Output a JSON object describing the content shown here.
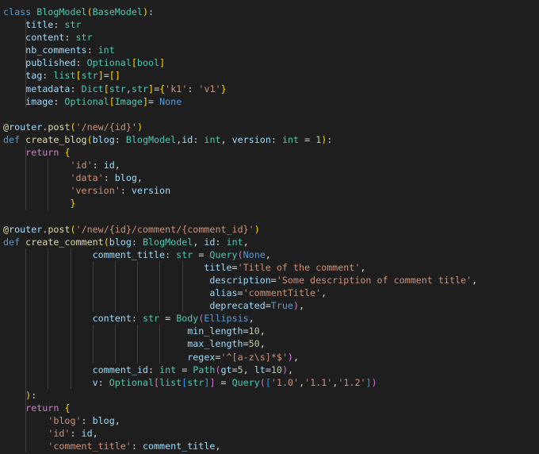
{
  "colors": {
    "background": "#1e1e1e",
    "default": "#d4d4d4",
    "keyword": "#569cd6",
    "control": "#c586c0",
    "function": "#dcdcaa",
    "class": "#4ec9b0",
    "variable": "#9cdcfe",
    "string": "#ce9178",
    "number": "#b5cea8",
    "bracket1": "#ffd700",
    "bracket2": "#da70d6",
    "bracket3": "#179fff",
    "indent_guide": "#404040"
  },
  "lines": [
    {
      "g": [],
      "t": [
        [
          "class",
          "kw"
        ],
        [
          " ",
          ""
        ],
        [
          "BlogModel",
          "cls"
        ],
        [
          "(",
          "br1"
        ],
        [
          "BaseModel",
          "cls"
        ],
        [
          ")",
          "br1"
        ],
        [
          ":",
          "pn"
        ]
      ]
    },
    {
      "g": [
        4
      ],
      "t": [
        [
          "    ",
          ""
        ],
        [
          "title",
          "var"
        ],
        [
          ": ",
          "pn"
        ],
        [
          "str",
          "cls"
        ]
      ]
    },
    {
      "g": [
        4
      ],
      "t": [
        [
          "    ",
          ""
        ],
        [
          "content",
          "var"
        ],
        [
          ": ",
          "pn"
        ],
        [
          "str",
          "cls"
        ]
      ]
    },
    {
      "g": [
        4
      ],
      "t": [
        [
          "    ",
          ""
        ],
        [
          "nb_comments",
          "var"
        ],
        [
          ": ",
          "pn"
        ],
        [
          "int",
          "cls"
        ]
      ]
    },
    {
      "g": [
        4
      ],
      "t": [
        [
          "    ",
          ""
        ],
        [
          "published",
          "var"
        ],
        [
          ": ",
          "pn"
        ],
        [
          "Optional",
          "cls"
        ],
        [
          "[",
          "br1"
        ],
        [
          "bool",
          "cls"
        ],
        [
          "]",
          "br1"
        ]
      ]
    },
    {
      "g": [
        4
      ],
      "t": [
        [
          "    ",
          ""
        ],
        [
          "tag",
          "var"
        ],
        [
          ": ",
          "pn"
        ],
        [
          "list",
          "cls"
        ],
        [
          "[",
          "br1"
        ],
        [
          "str",
          "cls"
        ],
        [
          "]",
          "br1"
        ],
        [
          "=",
          "pn"
        ],
        [
          "[",
          "br1"
        ],
        [
          "]",
          "br1"
        ]
      ]
    },
    {
      "g": [
        4
      ],
      "t": [
        [
          "    ",
          ""
        ],
        [
          "metadata",
          "var"
        ],
        [
          ": ",
          "pn"
        ],
        [
          "Dict",
          "cls"
        ],
        [
          "[",
          "br1"
        ],
        [
          "str",
          "cls"
        ],
        [
          ",",
          "pn"
        ],
        [
          "str",
          "cls"
        ],
        [
          "]",
          "br1"
        ],
        [
          "=",
          "pn"
        ],
        [
          "{",
          "br1"
        ],
        [
          "'k1'",
          "str"
        ],
        [
          ": ",
          "pn"
        ],
        [
          "'v1'",
          "str"
        ],
        [
          "}",
          "br1"
        ]
      ]
    },
    {
      "g": [
        4
      ],
      "t": [
        [
          "    ",
          ""
        ],
        [
          "image",
          "var"
        ],
        [
          ": ",
          "pn"
        ],
        [
          "Optional",
          "cls"
        ],
        [
          "[",
          "br1"
        ],
        [
          "Image",
          "cls"
        ],
        [
          "]",
          "br1"
        ],
        [
          "= ",
          "pn"
        ],
        [
          "None",
          "const"
        ]
      ]
    },
    {
      "g": [],
      "t": []
    },
    {
      "g": [],
      "t": [
        [
          "@",
          "fn"
        ],
        [
          "router",
          "var"
        ],
        [
          ".",
          "pn"
        ],
        [
          "post",
          "fn"
        ],
        [
          "(",
          "br1"
        ],
        [
          "'/new/{id}'",
          "str"
        ],
        [
          ")",
          "br1"
        ]
      ]
    },
    {
      "g": [],
      "t": [
        [
          "def",
          "kw"
        ],
        [
          " ",
          ""
        ],
        [
          "create_blog",
          "fn"
        ],
        [
          "(",
          "br1"
        ],
        [
          "blog",
          "var"
        ],
        [
          ": ",
          "pn"
        ],
        [
          "BlogModel",
          "cls"
        ],
        [
          ",",
          "pn"
        ],
        [
          "id",
          "var"
        ],
        [
          ": ",
          "pn"
        ],
        [
          "int",
          "cls"
        ],
        [
          ", ",
          "pn"
        ],
        [
          "version",
          "var"
        ],
        [
          ": ",
          "pn"
        ],
        [
          "int",
          "cls"
        ],
        [
          " = ",
          "pn"
        ],
        [
          "1",
          "num"
        ],
        [
          ")",
          "br1"
        ],
        [
          ":",
          "pn"
        ]
      ]
    },
    {
      "g": [
        4
      ],
      "t": [
        [
          "    ",
          ""
        ],
        [
          "return",
          "kw2"
        ],
        [
          " ",
          ""
        ],
        [
          "{",
          "br1"
        ]
      ]
    },
    {
      "g": [
        4,
        8
      ],
      "t": [
        [
          "            ",
          ""
        ],
        [
          "'id'",
          "str"
        ],
        [
          ": ",
          "pn"
        ],
        [
          "id",
          "var"
        ],
        [
          ",",
          "pn"
        ]
      ]
    },
    {
      "g": [
        4,
        8
      ],
      "t": [
        [
          "            ",
          ""
        ],
        [
          "'data'",
          "str"
        ],
        [
          ": ",
          "pn"
        ],
        [
          "blog",
          "var"
        ],
        [
          ",",
          "pn"
        ]
      ]
    },
    {
      "g": [
        4,
        8
      ],
      "t": [
        [
          "            ",
          ""
        ],
        [
          "'version'",
          "str"
        ],
        [
          ": ",
          "pn"
        ],
        [
          "version",
          "var"
        ]
      ]
    },
    {
      "g": [
        4,
        8
      ],
      "t": [
        [
          "            ",
          ""
        ],
        [
          "}",
          "br1"
        ]
      ]
    },
    {
      "g": [],
      "t": []
    },
    {
      "g": [],
      "t": [
        [
          "@",
          "fn"
        ],
        [
          "router",
          "var"
        ],
        [
          ".",
          "pn"
        ],
        [
          "post",
          "fn"
        ],
        [
          "(",
          "br1"
        ],
        [
          "'/new/{id}/comment/{comment_id}'",
          "str"
        ],
        [
          ")",
          "br1"
        ]
      ]
    },
    {
      "g": [],
      "t": [
        [
          "def",
          "kw"
        ],
        [
          " ",
          ""
        ],
        [
          "create_comment",
          "fn"
        ],
        [
          "(",
          "br1"
        ],
        [
          "blog",
          "var"
        ],
        [
          ": ",
          "pn"
        ],
        [
          "BlogModel",
          "cls"
        ],
        [
          ", ",
          "pn"
        ],
        [
          "id",
          "var"
        ],
        [
          ": ",
          "pn"
        ],
        [
          "int",
          "cls"
        ],
        [
          ",",
          "pn"
        ]
      ]
    },
    {
      "g": [
        4,
        8,
        12
      ],
      "t": [
        [
          "                ",
          ""
        ],
        [
          "comment_title",
          "var"
        ],
        [
          ": ",
          "pn"
        ],
        [
          "str",
          "cls"
        ],
        [
          " = ",
          "pn"
        ],
        [
          "Query",
          "cls"
        ],
        [
          "(",
          "br2"
        ],
        [
          "None",
          "const"
        ],
        [
          ",",
          "pn"
        ]
      ]
    },
    {
      "g": [
        4,
        8,
        12,
        16,
        20,
        24,
        28,
        32
      ],
      "t": [
        [
          "                                    ",
          ""
        ],
        [
          "title",
          "var"
        ],
        [
          "=",
          "pn"
        ],
        [
          "'Title of the comment'",
          "str"
        ],
        [
          ",",
          "pn"
        ]
      ]
    },
    {
      "g": [
        4,
        8,
        12,
        16,
        20,
        24,
        28,
        32
      ],
      "t": [
        [
          "                                     ",
          ""
        ],
        [
          "description",
          "var"
        ],
        [
          "=",
          "pn"
        ],
        [
          "'Some description of comment title'",
          "str"
        ],
        [
          ",",
          "pn"
        ]
      ]
    },
    {
      "g": [
        4,
        8,
        12,
        16,
        20,
        24,
        28,
        32
      ],
      "t": [
        [
          "                                     ",
          ""
        ],
        [
          "alias",
          "var"
        ],
        [
          "=",
          "pn"
        ],
        [
          "'commentTitle'",
          "str"
        ],
        [
          ",",
          "pn"
        ]
      ]
    },
    {
      "g": [
        4,
        8,
        12,
        16,
        20,
        24,
        28,
        32
      ],
      "t": [
        [
          "                                     ",
          ""
        ],
        [
          "deprecated",
          "var"
        ],
        [
          "=",
          "pn"
        ],
        [
          "True",
          "const"
        ],
        [
          ")",
          "br2"
        ],
        [
          ",",
          "pn"
        ]
      ]
    },
    {
      "g": [
        4,
        8,
        12
      ],
      "t": [
        [
          "                ",
          ""
        ],
        [
          "content",
          "var"
        ],
        [
          ": ",
          "pn"
        ],
        [
          "str",
          "cls"
        ],
        [
          " = ",
          "pn"
        ],
        [
          "Body",
          "cls"
        ],
        [
          "(",
          "br2"
        ],
        [
          "Ellipsis",
          "const"
        ],
        [
          ",",
          "pn"
        ]
      ]
    },
    {
      "g": [
        4,
        8,
        12,
        16,
        20,
        24,
        28
      ],
      "t": [
        [
          "                                 ",
          ""
        ],
        [
          "min_length",
          "var"
        ],
        [
          "=",
          "pn"
        ],
        [
          "10",
          "num"
        ],
        [
          ",",
          "pn"
        ]
      ]
    },
    {
      "g": [
        4,
        8,
        12,
        16,
        20,
        24,
        28
      ],
      "t": [
        [
          "                                 ",
          ""
        ],
        [
          "max_length",
          "var"
        ],
        [
          "=",
          "pn"
        ],
        [
          "50",
          "num"
        ],
        [
          ",",
          "pn"
        ]
      ]
    },
    {
      "g": [
        4,
        8,
        12,
        16,
        20,
        24,
        28
      ],
      "t": [
        [
          "                                 ",
          ""
        ],
        [
          "regex",
          "var"
        ],
        [
          "=",
          "pn"
        ],
        [
          "'^[a-z\\s]*$'",
          "str"
        ],
        [
          ")",
          "br2"
        ],
        [
          ",",
          "pn"
        ]
      ]
    },
    {
      "g": [
        4,
        8,
        12
      ],
      "t": [
        [
          "                ",
          ""
        ],
        [
          "comment_id",
          "var"
        ],
        [
          ": ",
          "pn"
        ],
        [
          "int",
          "cls"
        ],
        [
          " = ",
          "pn"
        ],
        [
          "Path",
          "cls"
        ],
        [
          "(",
          "br2"
        ],
        [
          "gt",
          "var"
        ],
        [
          "=",
          "pn"
        ],
        [
          "5",
          "num"
        ],
        [
          ", ",
          "pn"
        ],
        [
          "lt",
          "var"
        ],
        [
          "=",
          "pn"
        ],
        [
          "10",
          "num"
        ],
        [
          ")",
          "br2"
        ],
        [
          ",",
          "pn"
        ]
      ]
    },
    {
      "g": [
        4,
        8,
        12
      ],
      "t": [
        [
          "                ",
          ""
        ],
        [
          "v",
          "var"
        ],
        [
          ": ",
          "pn"
        ],
        [
          "Optional",
          "cls"
        ],
        [
          "[",
          "br2"
        ],
        [
          "list",
          "cls"
        ],
        [
          "[",
          "br3"
        ],
        [
          "str",
          "cls"
        ],
        [
          "]",
          "br3"
        ],
        [
          "]",
          "br2"
        ],
        [
          " = ",
          "pn"
        ],
        [
          "Query",
          "cls"
        ],
        [
          "(",
          "br2"
        ],
        [
          "[",
          "br3"
        ],
        [
          "'1.0'",
          "str"
        ],
        [
          ",",
          "pn"
        ],
        [
          "'1.1'",
          "str"
        ],
        [
          ",",
          "pn"
        ],
        [
          "'1.2'",
          "str"
        ],
        [
          "]",
          "br3"
        ],
        [
          ")",
          "br2"
        ]
      ]
    },
    {
      "g": [
        4
      ],
      "t": [
        [
          "    ",
          ""
        ],
        [
          ")",
          "br1"
        ],
        [
          ":",
          "pn"
        ]
      ]
    },
    {
      "g": [
        4
      ],
      "t": [
        [
          "    ",
          ""
        ],
        [
          "return",
          "kw2"
        ],
        [
          " ",
          ""
        ],
        [
          "{",
          "br1"
        ]
      ]
    },
    {
      "g": [
        4
      ],
      "t": [
        [
          "        ",
          ""
        ],
        [
          "'blog'",
          "str"
        ],
        [
          ": ",
          "pn"
        ],
        [
          "blog",
          "var"
        ],
        [
          ",",
          "pn"
        ]
      ]
    },
    {
      "g": [
        4
      ],
      "t": [
        [
          "        ",
          ""
        ],
        [
          "'id'",
          "str"
        ],
        [
          ": ",
          "pn"
        ],
        [
          "id",
          "var"
        ],
        [
          ",",
          "pn"
        ]
      ]
    },
    {
      "g": [
        4
      ],
      "t": [
        [
          "        ",
          ""
        ],
        [
          "'comment_title'",
          "str"
        ],
        [
          ": ",
          "pn"
        ],
        [
          "comment_title",
          "var"
        ],
        [
          ",",
          "pn"
        ]
      ]
    }
  ]
}
